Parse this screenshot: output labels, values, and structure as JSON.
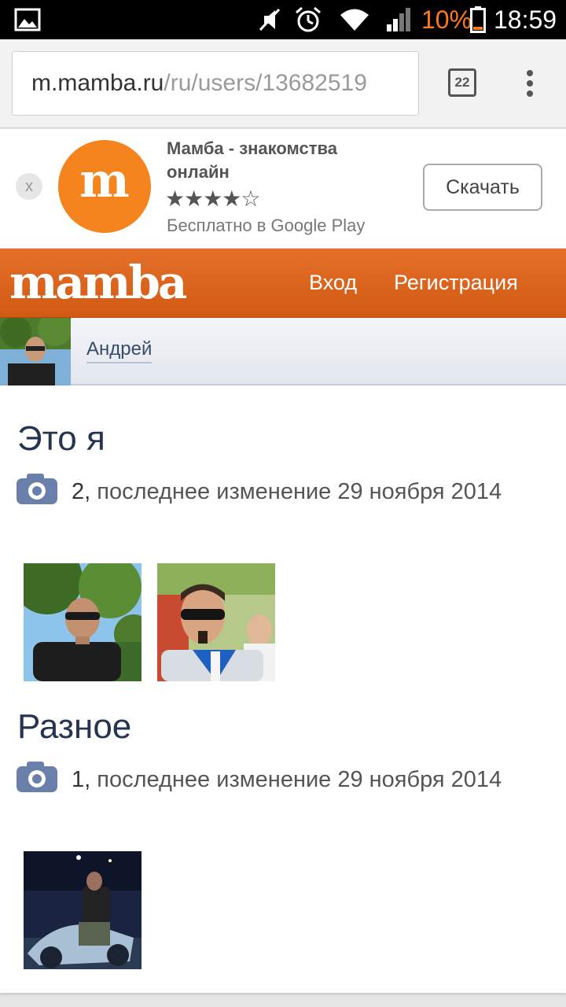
{
  "status_bar": {
    "battery_percent": "10%",
    "time": "18:59"
  },
  "browser": {
    "url_host": "m.mamba.ru",
    "url_path": "/ru/users/13682519",
    "tab_count": "22"
  },
  "app_banner": {
    "close_label": "x",
    "logo_letter": "m",
    "title": "Мамба - знакомства онлайн",
    "rating_filled": "★★★★",
    "rating_empty": "☆",
    "rating_value": 4,
    "rating_max": 5,
    "subtitle": "Бесплатно в Google Play",
    "download_label": "Скачать",
    "logo_color": "#f5841f"
  },
  "site_header": {
    "logo": "mamba",
    "login_label": "Вход",
    "register_label": "Регистрация",
    "brand_color": "#de6520"
  },
  "user": {
    "name": "Андрей"
  },
  "albums": [
    {
      "title": "Это я",
      "count": "2,",
      "meta": " последнее изменение 29 ноября 2014"
    },
    {
      "title": "Разное",
      "count": "1,",
      "meta": " последнее изменение 29 ноября 2014"
    }
  ]
}
